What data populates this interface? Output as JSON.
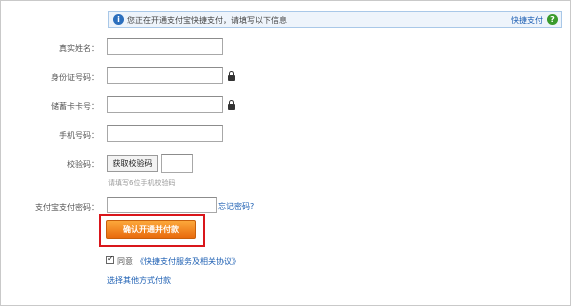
{
  "info_bar": {
    "message": "您正在开通支付宝快捷支付，请填写以下信息",
    "quickpay_link": "快捷支付",
    "info_icon_glyph": "i",
    "help_icon_glyph": "?"
  },
  "form": {
    "real_name_label": "真实姓名：",
    "id_number_label": "身份证号码：",
    "card_number_label": "储蓄卡卡号：",
    "phone_label": "手机号码：",
    "verify_code_label": "校验码：",
    "get_code_button": "获取校验码",
    "code_hint": "请填写6位手机校验码",
    "alipay_password_label": "支付宝支付密码：",
    "forgot_password_link": "忘记密码?",
    "confirm_button": "确认开通并付款",
    "agree_checkbox_checked": true,
    "agree_label": "同意",
    "agreement_link": "《快捷支付服务及相关协议》",
    "other_payment_link": "选择其他方式付款"
  },
  "colors": {
    "highlight_border": "#d9161b",
    "confirm_button": "#f08a1e",
    "link": "#1a5db2"
  }
}
